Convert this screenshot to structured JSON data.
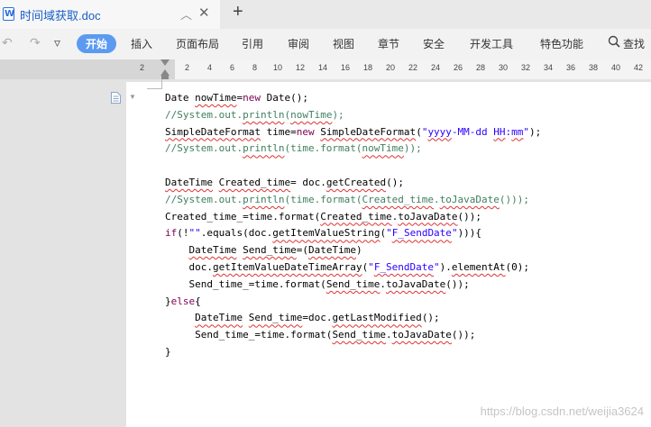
{
  "tab": {
    "icon_letter": "W",
    "title": "时间域获取.doc"
  },
  "icons": [
    "word-doc-icon",
    "minimize-up-icon",
    "close-icon",
    "add-tab-icon",
    "undo-icon",
    "redo-icon",
    "dropdown-icon",
    "search-icon",
    "document-nav-icon",
    "collapse-caret-icon"
  ],
  "toolbar": {
    "undo": "↶",
    "redo": "↷",
    "more": "▿",
    "menu": [
      "开始",
      "插入",
      "页面布局",
      "引用",
      "审阅",
      "视图",
      "章节",
      "安全",
      "开发工具",
      "特色功能"
    ],
    "search_label": "查找"
  },
  "ruler": {
    "ticks": [
      "2",
      "2",
      "4",
      "6",
      "8",
      "10",
      "12",
      "14",
      "16",
      "18",
      "20",
      "22",
      "24",
      "26",
      "28",
      "30",
      "32",
      "34",
      "36",
      "38",
      "40",
      "42"
    ]
  },
  "code_lines": [
    [
      {
        "t": "Date nowTime=",
        "c": ""
      },
      {
        "t": "new",
        "c": "kw"
      },
      {
        "t": " Date();",
        "c": ""
      }
    ],
    [
      {
        "t": "//System.out.println(nowTime);",
        "c": "cm"
      }
    ],
    [
      {
        "t": "SimpleDateFormat time=",
        "c": ""
      },
      {
        "t": "new",
        "c": "kw"
      },
      {
        "t": " SimpleDateFormat(",
        "c": ""
      },
      {
        "t": "\"yyyy-MM-dd HH:mm\"",
        "c": "st"
      },
      {
        "t": ");",
        "c": ""
      }
    ],
    [
      {
        "t": "//System.out.println(time.format(nowTime));",
        "c": "cm"
      }
    ],
    [],
    [
      {
        "t": "DateTime Created_time= doc.getCreated();",
        "c": ""
      }
    ],
    [
      {
        "t": "//System.out.println(time.format(Created_time.toJavaDate()));",
        "c": "cm"
      }
    ],
    [
      {
        "t": "Created_time_=time.format(Created_time.toJavaDate());",
        "c": ""
      }
    ],
    [
      {
        "t": "if",
        "c": "kw"
      },
      {
        "t": "(!",
        "c": ""
      },
      {
        "t": "\"\"",
        "c": "st"
      },
      {
        "t": ".equals(doc.getItemValueString(",
        "c": ""
      },
      {
        "t": "\"F_SendDate\"",
        "c": "st"
      },
      {
        "t": "))){",
        "c": ""
      }
    ],
    [
      {
        "t": "    DateTime Send_time=(DateTime)",
        "c": ""
      }
    ],
    [
      {
        "t": "    doc.getItemValueDateTimeArray(",
        "c": ""
      },
      {
        "t": "\"F_SendDate\"",
        "c": "st"
      },
      {
        "t": ").elementAt(0);",
        "c": ""
      }
    ],
    [
      {
        "t": "    Send_time_=time.format(Send_time.toJavaDate());",
        "c": ""
      }
    ],
    [
      {
        "t": "}",
        "c": ""
      },
      {
        "t": "else",
        "c": "kw"
      },
      {
        "t": "{",
        "c": ""
      }
    ],
    [
      {
        "t": "     DateTime Send_time=doc.getLastModified();",
        "c": ""
      }
    ],
    [
      {
        "t": "     Send_time_=time.format(Send_time.toJavaDate());",
        "c": ""
      }
    ],
    [
      {
        "t": "}",
        "c": ""
      }
    ]
  ],
  "watermark": "https://blog.csdn.net/weijia3624"
}
